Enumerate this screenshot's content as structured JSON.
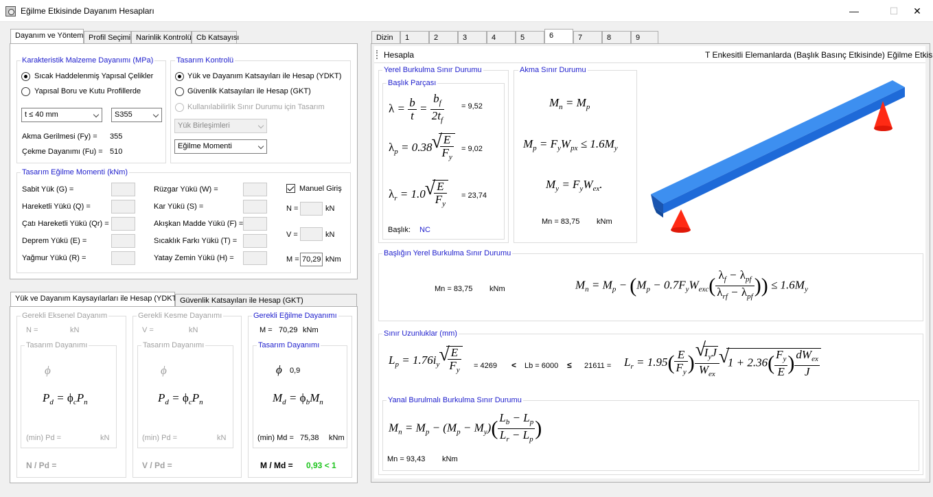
{
  "window": {
    "title": "Eğilme Etkisinde Dayanım Hesapları",
    "minimize": "—",
    "maximize": "☐",
    "close": "✕"
  },
  "left_tabs": [
    "Dayanım ve Yöntem",
    "Profil Seçimi",
    "Narinlik Kontrolü",
    "Cb Katsayısı"
  ],
  "material": {
    "title": "Karakteristik Malzeme Dayanımı (MPa)",
    "radio1": "Sıcak Haddelenmiş Yapısal Çelikler",
    "radio2": "Yapısal Boru ve Kutu Profillerde",
    "thickness": "t ≤ 40 mm",
    "steel": "S355",
    "fy_label": "Akma Gerilmesi (Fy) =",
    "fy": "355",
    "fu_label": "Çekme Dayanımı (Fu) =",
    "fu": "510"
  },
  "design": {
    "title": "Tasarım Kontrolü",
    "radio1": "Yük ve Dayanım Katsayıları ile Hesap (YDKT)",
    "radio2": "Güvenlik Katsayıları ile Hesap (GKT)",
    "radio3": "Kullanılabilirlik Sınır Durumu için Tasarım",
    "combo1": "Yük Birleşimleri",
    "combo2": "Eğilme Momenti"
  },
  "moments": {
    "title": "Tasarım Eğilme Momenti (kNm)",
    "left": [
      "Sabit Yük (G) =",
      "Hareketli Yükü (Q) =",
      "Çatı Hareketli Yükü (Qr) =",
      "Deprem Yükü (E) =",
      "Yağmur Yükü (R) ="
    ],
    "mid": [
      "Rüzgar Yükü (W) =",
      "Kar Yükü (S) =",
      "Akışkan Madde Yükü (F) =",
      "Sıcaklık Farkı Yükü (T) =",
      "Yatay Zemin Yükü (H) ="
    ],
    "manual": "Manuel Giriş",
    "n_label": "N =",
    "v_label": "V =",
    "m_label": "M =",
    "m_value": "70,29",
    "kn": "kN",
    "knm": "kNm"
  },
  "bottom_tabs": [
    "Yük ve Dayanım Kaysayılarları ile Hesap (YDKT)",
    "Güvenlik Katsayıları ile Hesap (GKT)"
  ],
  "axial": {
    "title": "Gerekli Eksenel Dayanım",
    "n": "N =",
    "unit": "kN",
    "sub": "Tasarım Dayanımı",
    "phi": "ϕ",
    "pd": "(min) Pd =",
    "ratio": "N / Pd ="
  },
  "shear": {
    "title": "Gerekli Kesme Dayanımı",
    "v": "V =",
    "unit": "kN",
    "sub": "Tasarım Dayanımı",
    "phi": "ϕ",
    "pd": "(min) Pd =",
    "ratio": "V / Pd ="
  },
  "bending": {
    "title": "Gerekli Eğilme Dayanımı",
    "m": "M =",
    "m_val": "70,29",
    "unit": "kNm",
    "sub": "Tasarım Dayanımı",
    "phi": "ϕ",
    "phi_val": "0,9",
    "md": "(min) Md =",
    "md_val": "75,38",
    "ratio": "M / Md =",
    "ratio_val": "0,93 < 1"
  },
  "right_tabs": [
    "Dizin",
    "1",
    "2",
    "3",
    "4",
    "5",
    "6",
    "7",
    "8",
    "9"
  ],
  "toolbar": {
    "button": "Hesapla",
    "heading": "T Enkesitli Elemanlarda (Başlık Basınç Etkisinde) Eğilme Etkisi"
  },
  "local": {
    "title": "Yerel Burkulma Sınır Durumu",
    "flange": "Başlık Parçası",
    "lambda": "= 9,52",
    "lambda_p": "= 9,02",
    "lambda_r": "= 23,74",
    "class_label": "Başlık:",
    "class_val": "NC"
  },
  "yield": {
    "title": "Akma Sınır Durumu",
    "mn": "Mn = 83,75",
    "unit": "kNm"
  },
  "flb": {
    "title": "Başlığın Yerel Burkulma Sınır Durumu",
    "mn": "Mn = 83,75",
    "unit": "kNm"
  },
  "lengths": {
    "title": "Sınır Uzunluklar (mm)",
    "lp": "= 4269",
    "lt": "<",
    "lb": "Lb = 6000",
    "le": "≤",
    "lr": "21611 ="
  },
  "ltb": {
    "title": "Yanal Burulmalı Burkulma Sınır Durumu",
    "mn": "Mn = 93,43",
    "unit": "kNm"
  },
  "colors": {
    "accent": "#1c1ccc",
    "beam": "#2a7fe0",
    "support": "#f03020",
    "ok": "#1ec41e"
  }
}
